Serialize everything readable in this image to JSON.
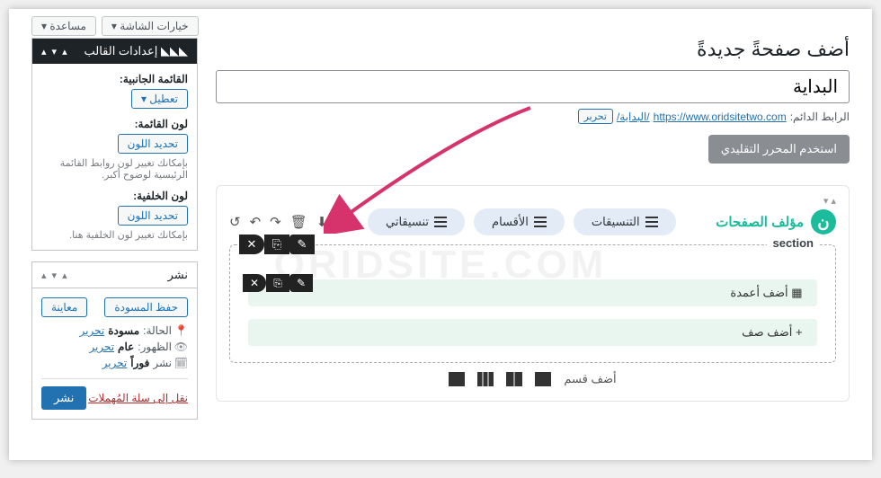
{
  "topbar": {
    "screen_options": "خيارات الشاشة ▾",
    "help": "مساعدة ▾"
  },
  "page": {
    "heading": "أضف صفحةً جديدةً",
    "title_value": "البداية",
    "permalink_label": "الرابط الدائم:",
    "permalink_base": "https://www.oridsitetwo.com",
    "permalink_slug": "/البداية/",
    "edit": "تحرير",
    "use_classic": "استخدم المحرر التقليدي"
  },
  "builder": {
    "brand": "مؤلف الصفحات",
    "tabs": {
      "layouts": "التنسيقات",
      "sections": "الأقسام",
      "my_layouts": "تنسيقاتي"
    },
    "section_label": "section",
    "add_columns": "▦  أضف أعمدة",
    "add_row": "+  أضف صف",
    "add_section": "أضف قسم"
  },
  "theme_box": {
    "title": "إعدادات القالب",
    "side_menu_label": "القائمة الجانبية:",
    "side_menu_value": "تعطيل ▾",
    "menu_color_label": "لون القائمة:",
    "select_color": "تحديد اللون",
    "menu_color_help": "بإمكانك تغيير لون روابط القائمة الرئيسية لوضوح أكبر.",
    "bg_color_label": "لون الخلفية:",
    "bg_color_help": "بإمكانك تغيير لون الخلفية هنا."
  },
  "publish_box": {
    "title": "نشر",
    "save_draft": "حفظ المسودة",
    "preview": "معاينة",
    "status_label": "الحالة:",
    "status_value": "مسودة",
    "visibility_label": "الظهور:",
    "visibility_value": "عام",
    "schedule_label": "نشر",
    "schedule_value": "فوراً",
    "edit": "تحرير",
    "trash": "نقل إلى سلة المُهملات",
    "publish": "نشر"
  },
  "watermark": "ORIDSITE.COM"
}
